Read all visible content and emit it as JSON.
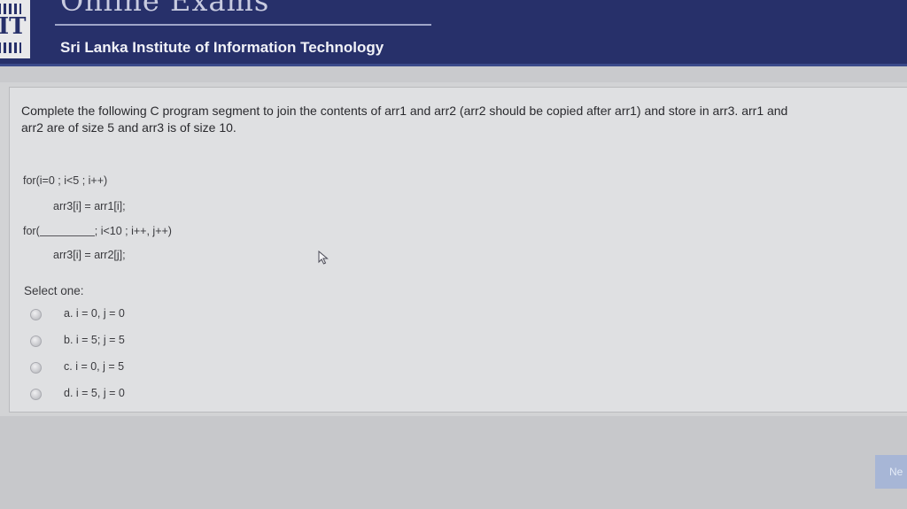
{
  "header": {
    "logo_text": "IT",
    "banner_title": "Online Exams",
    "institute": "Sri Lanka Institute of Information Technology"
  },
  "question": {
    "text_line1": "Complete the following C program segment to join the contents of arr1 and arr2 (arr2 should be copied after arr1) and store in arr3. arr1 and",
    "text_line2": "arr2 are of size 5 and arr3 is of size 10.",
    "code": {
      "line1": "for(i=0 ; i<5 ; i++)",
      "line2": "arr3[i] = arr1[i];",
      "line3_prefix": "for(",
      "line3_suffix": "; i<10 ; i++, j++)",
      "line4": "arr3[i] = arr2[j];"
    },
    "select_label": "Select one:",
    "options": [
      {
        "label": "a. i = 0, j = 0"
      },
      {
        "label": "b. i = 5; j = 5"
      },
      {
        "label": "c. i = 0, j = 5"
      },
      {
        "label": "d. i = 5, j = 0"
      }
    ]
  },
  "navigation": {
    "next_label": "Ne"
  },
  "icons": {
    "cursor": "mouse-pointer-icon",
    "radio": "radio-button-icon"
  },
  "colors": {
    "header_bg": "#27306a",
    "page_bg": "#dfe0e2",
    "next_button": "#a7b6d6"
  }
}
